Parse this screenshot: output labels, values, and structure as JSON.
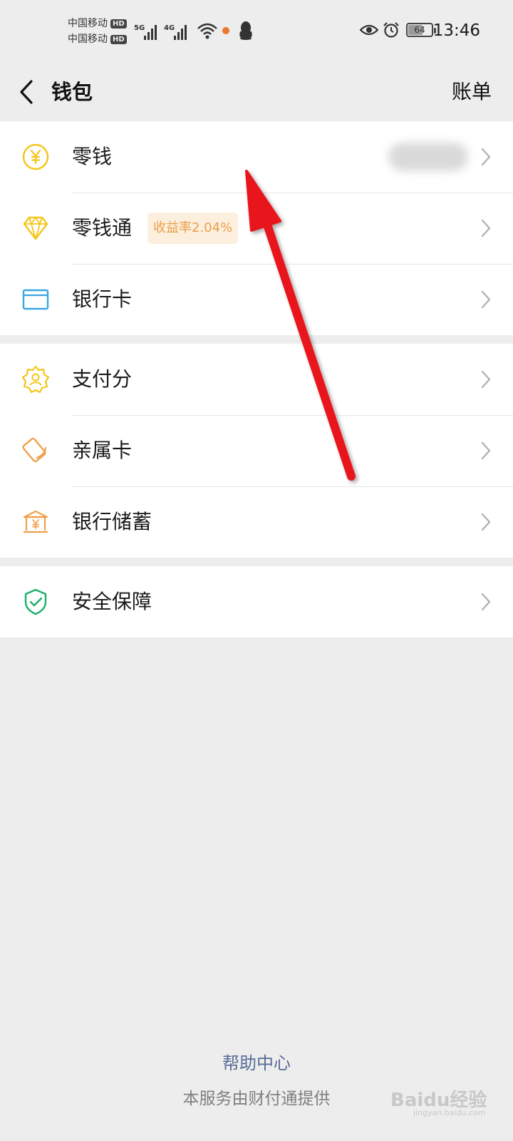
{
  "status_bar": {
    "carrier_1": "中国移动",
    "carrier_2": "中国移动",
    "hd_label": "HD",
    "signal_1_tag": "5G",
    "signal_2_tag": "4G",
    "battery_level": "64",
    "battery_percent": 64,
    "time": "13:46"
  },
  "nav": {
    "title": "钱包",
    "action_label": "账单"
  },
  "groups": [
    {
      "items": [
        {
          "label": "零钱",
          "icon": "yuan-coin-icon",
          "value_blurred": true
        },
        {
          "label": "零钱通",
          "icon": "diamond-icon",
          "badge": "收益率2.04%"
        },
        {
          "label": "银行卡",
          "icon": "bank-card-icon"
        }
      ]
    },
    {
      "items": [
        {
          "label": "支付分",
          "icon": "badge-user-icon"
        },
        {
          "label": "亲属卡",
          "icon": "family-card-icon"
        },
        {
          "label": "银行储蓄",
          "icon": "bank-building-icon"
        }
      ]
    },
    {
      "items": [
        {
          "label": "安全保障",
          "icon": "shield-check-icon"
        }
      ]
    }
  ],
  "footer": {
    "help_label": "帮助中心",
    "provider_text": "本服务由财付通提供"
  },
  "watermark": {
    "brand": "Baidu经验",
    "sub": "jingyan.baidu.com"
  },
  "colors": {
    "background": "#ededed",
    "yellow_icon": "#f5c518",
    "orange_icon": "#f0a04b",
    "blue_icon": "#3aa7e0",
    "green_icon": "#17b26a",
    "badge_bg": "#fdefdd",
    "badge_text": "#e9a04a",
    "link": "#576b95",
    "annotation": "#e8131a"
  }
}
